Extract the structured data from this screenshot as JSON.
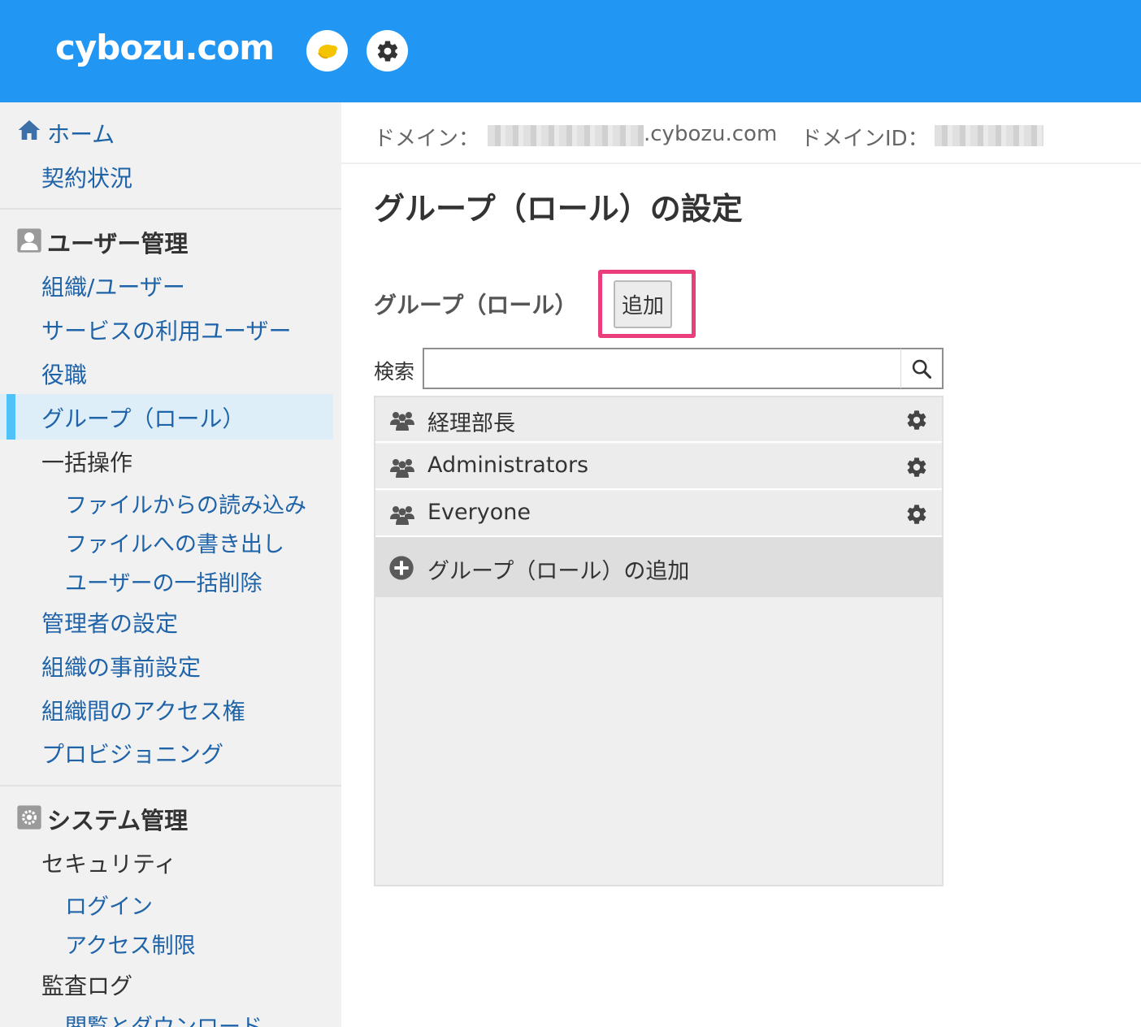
{
  "header": {
    "logo": "cybozu.com",
    "app_icon": "app-icon",
    "settings_icon": "gear-icon"
  },
  "sidebar": {
    "home_section": {
      "home": "ホーム",
      "contract": "契約状況"
    },
    "user_section": {
      "title": "ユーザー管理",
      "items": [
        "組織/ユーザー",
        "サービスの利用ユーザー",
        "役職",
        "グループ（ロール）",
        "一括操作"
      ],
      "bulk_sub": [
        "ファイルからの読み込み",
        "ファイルへの書き出し",
        "ユーザーの一括削除"
      ],
      "items2": [
        "管理者の設定",
        "組織の事前設定",
        "組織間のアクセス権",
        "プロビジョニング"
      ]
    },
    "system_section": {
      "title": "システム管理",
      "security": "セキュリティ",
      "security_sub": [
        "ログイン",
        "アクセス制限"
      ],
      "audit": "監査ログ",
      "audit_sub": [
        "閲覧とダウンロード"
      ]
    }
  },
  "domain_bar": {
    "domain_label": "ドメイン：",
    "domain_suffix": ".cybozu.com",
    "domain_id_label": "ドメインID："
  },
  "main": {
    "title": "グループ（ロール）の設定",
    "group_label": "グループ（ロール）",
    "add_button": "追加",
    "search_label": "検索",
    "search_value": "",
    "groups": [
      "経理部長",
      "Administrators",
      "Everyone"
    ],
    "add_group_label": "グループ（ロール）の追加"
  },
  "colors": {
    "header": "#2196f3",
    "link": "#1f63a8",
    "active_bar": "#4fc3f7",
    "highlight": "#ea3e7c"
  }
}
